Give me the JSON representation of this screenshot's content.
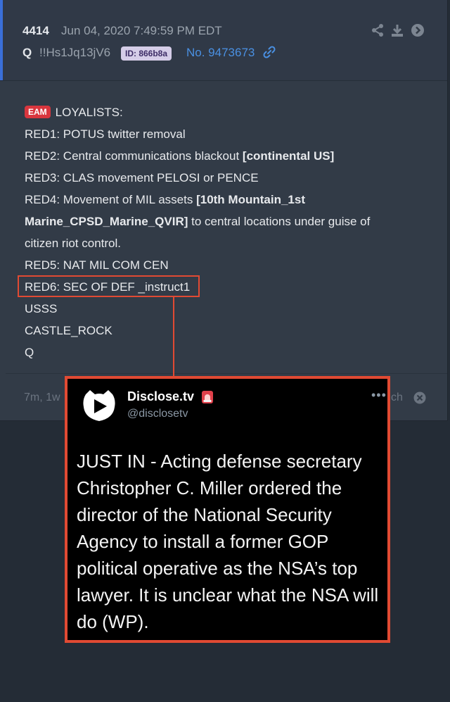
{
  "post": {
    "number": "4414",
    "date": "Jun 04, 2020 7:49:59 PM EDT",
    "author": "Q",
    "tripcode": "!!Hs1Jq13jV6",
    "id_badge": "ID: 866b8a",
    "post_no": "No. 9473673",
    "lines": {
      "eam": "EAM",
      "l1": "LOYALISTS:",
      "l2": "RED1: POTUS twitter removal",
      "l3a": "RED2: Central communications blackout ",
      "l3b": "[continental US]",
      "l4": "RED3: CLAS movement PELOSI or PENCE",
      "l5a": "RED4: Movement of MIL assets ",
      "l5b": "[10th Mountain_1st",
      "l6a": "Marine_CPSD_Marine_QVIR]",
      "l6b": " to central locations under guise of",
      "l7": "citizen riot control.",
      "l8": "RED5: NAT MIL COM CEN",
      "l9": "RED6: SEC OF DEF _instruct1",
      "l10": "USSS",
      "l11": "CASTLE_ROCK",
      "l12": "Q"
    },
    "footer_left": "7m, 1w",
    "footer_right": "ch"
  },
  "tweet": {
    "name": "Disclose.tv",
    "handle": "@disclosetv",
    "more": "•••",
    "text_lines": [
      "JUST IN - Acting defense secretary",
      "Christopher C. Miller ordered the",
      "director of the National Security",
      "Agency to install a former GOP",
      "political operative as the NSA’s top",
      "lawyer. It is unclear what the NSA will",
      "do (WP)."
    ]
  },
  "colors": {
    "highlight": "#e14a33",
    "link": "#4a90e2",
    "badge_red": "#d9363e"
  },
  "icons": [
    "share-icon",
    "download-icon",
    "arrow-right-circle-icon",
    "link-icon",
    "close-icon",
    "disclose-logo-icon",
    "siren-icon"
  ]
}
